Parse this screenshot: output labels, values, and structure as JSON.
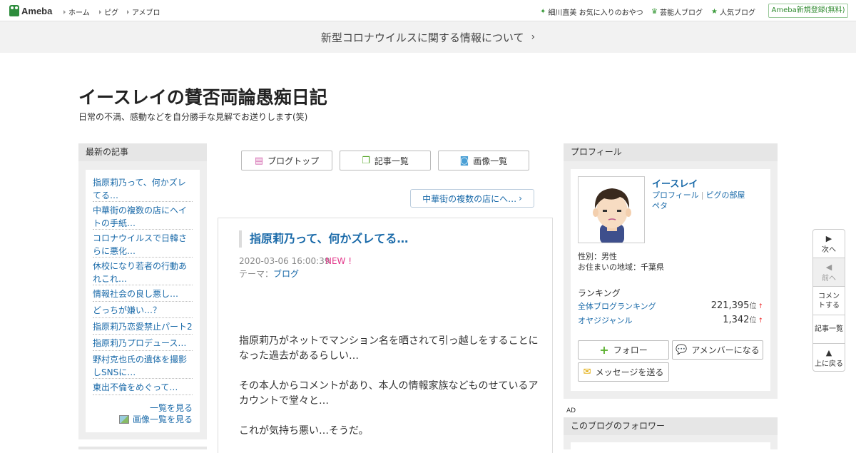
{
  "topbar": {
    "logo": "Ameba",
    "global_nav": [
      "ホーム",
      "ピグ",
      "アメブロ"
    ],
    "right_nav": [
      {
        "icon": "sparkle-icon",
        "label": "細川直美 お気に入りのおやつ"
      },
      {
        "icon": "crown-icon",
        "label": "芸能人ブログ"
      },
      {
        "icon": "star-icon",
        "label": "人気ブログ"
      }
    ],
    "signup": "Ameba新規登録(無料)"
  },
  "notice": {
    "text": "新型コロナウイルスに関する情報について",
    "chevron": "›"
  },
  "blog": {
    "title": "イースレイの賛否両論愚痴日記",
    "description": "日常の不満、感動などを自分勝手な見解でお送りします(笑)"
  },
  "sidebar_left": {
    "header": "最新の記事",
    "recent_posts": [
      "指原莉乃って、何かズレてる…",
      "中華街の複数の店にヘイトの手紙…",
      "コロナウイルスで日韓さらに悪化…",
      "休校になり若者の行動あれこれ…",
      "情報社会の良し悪し…",
      "どっちが嫌い…？",
      "指原莉乃恋愛禁止パート2",
      "指原莉乃プロデュース…",
      "野村克也氏の遺体を撮影しSNSに…",
      "東出不倫をめぐって…"
    ],
    "see_all": "一覧を見る",
    "see_images": "画像一覧を見る"
  },
  "center": {
    "nav_buttons": [
      "ブログトップ",
      "記事一覧",
      "画像一覧"
    ],
    "next_post": "中華街の複数の店にへ…",
    "article": {
      "title": "指原莉乃って、何かズレてる…",
      "date": "2020-03-06 16:00:39",
      "new_badge": "NEW !",
      "theme_label": "テーマ：",
      "theme": "ブログ",
      "paragraphs": [
        "指原莉乃がネットでマンション名を晒されて引っ越しをすることになった過去があるらしい…",
        "その本人からコメントがあり、本人の情報家族などものせているアカウントで堂々と…",
        "これが気持ち悪い…そうだ。"
      ]
    }
  },
  "profile": {
    "header": "プロフィール",
    "name": "イースレイ",
    "link_profile": "プロフィール",
    "link_room": "ピグの部屋",
    "link_peta": "ペタ",
    "gender": "性別：男性",
    "region": "お住まいの地域：千葉県",
    "ranking_title": "ランキング",
    "rankings": [
      {
        "label": "全体ブログランキング",
        "value": "221,395",
        "unit": "位",
        "arrow": "↑"
      },
      {
        "label": "オヤジジャンル",
        "value": "1,342",
        "unit": "位",
        "arrow": "↑"
      }
    ],
    "follow_btn": "フォロー",
    "amember_btn": "アメンバーになる",
    "message_btn": "メッセージを送る"
  },
  "ad_label": "AD",
  "followers_header": "このブログのフォロワー",
  "float_nav": {
    "next": "次へ",
    "prev": "前へ",
    "comment": "コメントする",
    "list": "記事一覧",
    "top": "上に戻る"
  },
  "colors": {
    "link": "#1a6aa9",
    "new": "#e3398b",
    "brand_green": "#2d8c3c"
  }
}
